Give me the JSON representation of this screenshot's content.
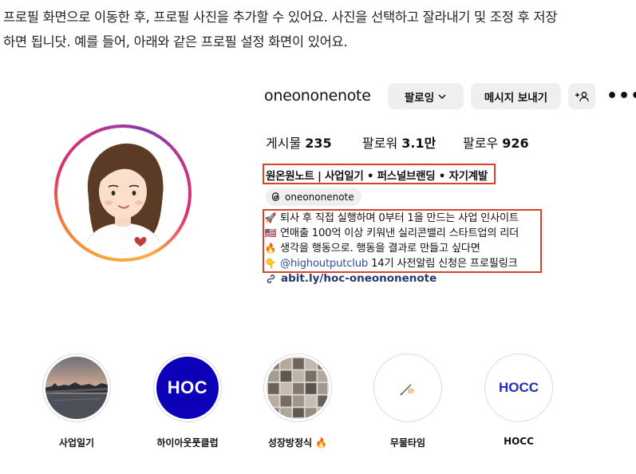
{
  "intro": {
    "line1": "프로필 화면으로 이동한 후, 프로필 사진을 추가할 수 있어요. 사진을 선택하고 잘라내기 및 조정 후 저장",
    "line2": "하면 됩니닷. 예를 들어, 아래와 같은 프로필 설정 화면이 있어요."
  },
  "profile": {
    "username": "oneononenote",
    "follow_button": "팔로잉",
    "message_button": "메시지 보내기",
    "suggest_icon": "add-person-icon",
    "more_icon": "more-icon",
    "stats": {
      "posts_label": "게시물",
      "posts_value": "235",
      "followers_label": "팔로워",
      "followers_value": "3.1만",
      "following_label": "팔로우",
      "following_value": "926"
    },
    "bio_name": "원온원노트 | 사업일기 • 퍼스널브랜딩 • 자기계발",
    "threads_handle": "oneononenote",
    "bio_lines": [
      {
        "emoji": "🚀",
        "text": "퇴사 후 직접 실행하며 0부터 1을 만드는 사업 인사이트"
      },
      {
        "emoji": "🇺🇸",
        "text": "연매출 100억 이상 키워낸 실리콘밸리 스타트업의 리더"
      },
      {
        "emoji": "🔥",
        "text": "생각을 행동으로. 행동을 결과로 만들고 싶다면"
      },
      {
        "emoji": "👇",
        "mention": "@highoutputclub",
        "text": " 14기 사전알림 신청은 프로필링크"
      }
    ],
    "link": "abit.ly/hoc-oneononenote",
    "colors": {
      "accent_box": "#d9432e",
      "button_bg": "#efefef",
      "link": "#233a70"
    }
  },
  "highlights": [
    {
      "label": "사업일기"
    },
    {
      "label": "하이아웃풋클럽",
      "cover_text": "HOC"
    },
    {
      "label": "성장방정식 🔥"
    },
    {
      "label": "무물타임",
      "cover_icon": "writing-hand-icon"
    },
    {
      "label": "HOCC",
      "cover_text": "HOCC"
    }
  ]
}
